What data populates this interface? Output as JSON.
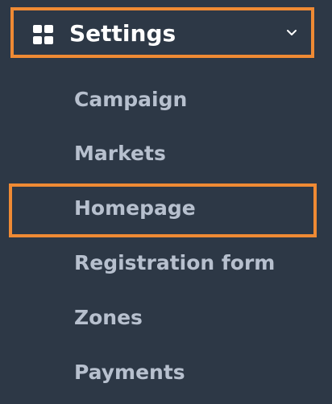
{
  "sidebar": {
    "header": {
      "label": "Settings",
      "icon": "grid-icon",
      "chevron_icon": "chevron-down-icon"
    },
    "submenu": [
      {
        "label": "Campaign"
      },
      {
        "label": "Markets"
      },
      {
        "label": "Homepage"
      },
      {
        "label": "Registration form"
      },
      {
        "label": "Zones"
      },
      {
        "label": "Payments"
      }
    ]
  },
  "colors": {
    "background": "#2d3846",
    "highlight": "#ef8a34",
    "header_text": "#ffffff",
    "submenu_text": "#b7c0ce"
  }
}
